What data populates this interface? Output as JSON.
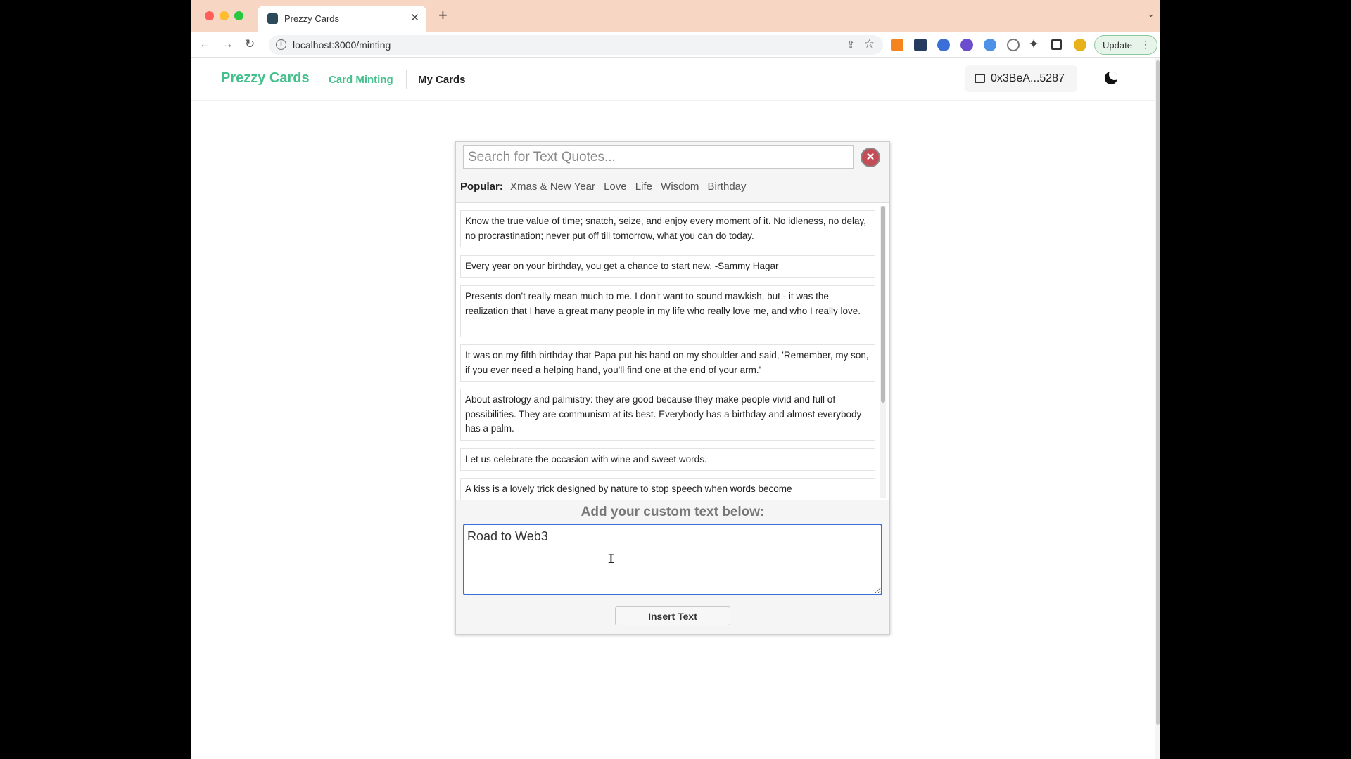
{
  "browser": {
    "tab_title": "Prezzy Cards",
    "url": "localhost:3000/minting",
    "update_label": "Update"
  },
  "header": {
    "brand": "Prezzy Cards",
    "nav": {
      "minting": "Card Minting",
      "my_cards": "My Cards"
    },
    "wallet_address": "0x3BeA...5287"
  },
  "quotes_panel": {
    "search_placeholder": "Search for Text Quotes...",
    "popular_label": "Popular:",
    "tags": [
      "Xmas & New Year",
      "Love",
      "Life",
      "Wisdom",
      "Birthday"
    ],
    "quotes": [
      "Know the true value of time; snatch, seize, and enjoy every moment of it. No idleness, no delay, no procrastination; never put off till tomorrow, what you can do today.",
      "Every year on your birthday, you get a chance to start new. -Sammy Hagar",
      "Presents don't really mean much to me. I don't want to sound mawkish, but - it was the realization that I have a great many people in my life who really love me, and who I really love.",
      "It was on my fifth birthday that Papa put his hand on my shoulder and said, 'Remember, my son, if you ever need a helping hand, you'll find one at the end of your arm.'",
      "About astrology and palmistry: they are good because they make people vivid and full of possibilities. They are communism at its best. Everybody has a birthday and almost everybody has a palm.",
      "Let us celebrate the occasion with wine and sweet words.",
      "A kiss is a lovely trick designed by nature to stop speech when words become"
    ]
  },
  "custom": {
    "label": "Add your custom text below:",
    "value": "Road to Web3",
    "insert_label": "Insert Text"
  }
}
